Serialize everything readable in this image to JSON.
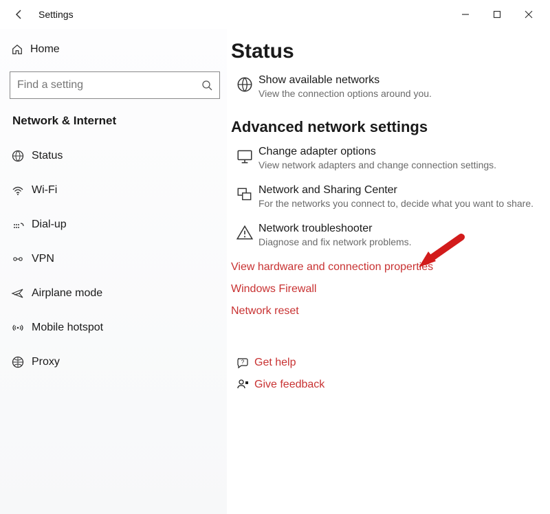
{
  "window": {
    "title": "Settings"
  },
  "sidebar": {
    "home": "Home",
    "search_placeholder": "Find a setting",
    "category": "Network & Internet",
    "items": [
      {
        "label": "Status"
      },
      {
        "label": "Wi-Fi"
      },
      {
        "label": "Dial-up"
      },
      {
        "label": "VPN"
      },
      {
        "label": "Airplane mode"
      },
      {
        "label": "Mobile hotspot"
      },
      {
        "label": "Proxy"
      }
    ]
  },
  "main": {
    "heading": "Status",
    "show_networks": {
      "title": "Show available networks",
      "desc": "View the connection options around you."
    },
    "advanced_heading": "Advanced network settings",
    "adapter": {
      "title": "Change adapter options",
      "desc": "View network adapters and change connection settings."
    },
    "sharing": {
      "title": "Network and Sharing Center",
      "desc": "For the networks you connect to, decide what you want to share."
    },
    "troubleshooter": {
      "title": "Network troubleshooter",
      "desc": "Diagnose and fix network problems."
    },
    "links": {
      "hardware": "View hardware and connection properties",
      "firewall": "Windows Firewall",
      "reset": "Network reset"
    },
    "help": {
      "get": "Get help",
      "feedback": "Give feedback"
    }
  }
}
